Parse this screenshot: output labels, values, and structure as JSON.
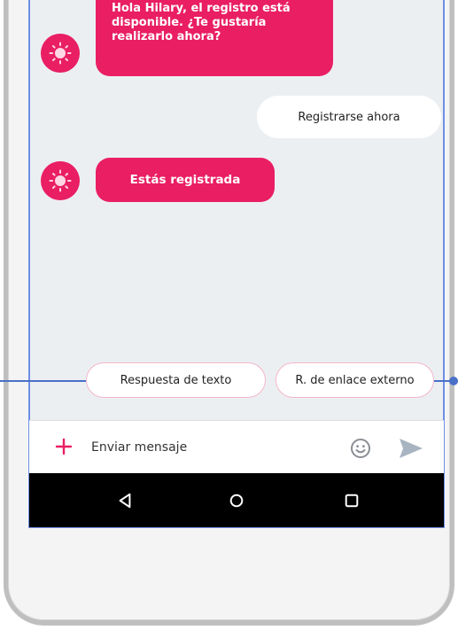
{
  "conversation": {
    "messages": [
      {
        "sender": "bot",
        "text": "Hola Hilary, el registro está disponible. ¿Te gustaría realizarlo ahora?"
      },
      {
        "sender": "user",
        "text": "Registrarse ahora"
      },
      {
        "sender": "bot",
        "text": "Estás registrada"
      }
    ]
  },
  "suggestions": [
    {
      "label": "Respuesta de texto"
    },
    {
      "label": "R. de enlace externo"
    }
  ],
  "composer": {
    "placeholder": "Enviar mensaje",
    "icons": [
      "plus-icon",
      "emoji-icon",
      "send-icon"
    ]
  },
  "navbar": {
    "icons": [
      "back-icon",
      "home-icon",
      "recents-icon"
    ]
  },
  "colors": {
    "brand": "#e91e63",
    "chat_background": "#eceff2",
    "guide_lines": "#4a70c8"
  }
}
